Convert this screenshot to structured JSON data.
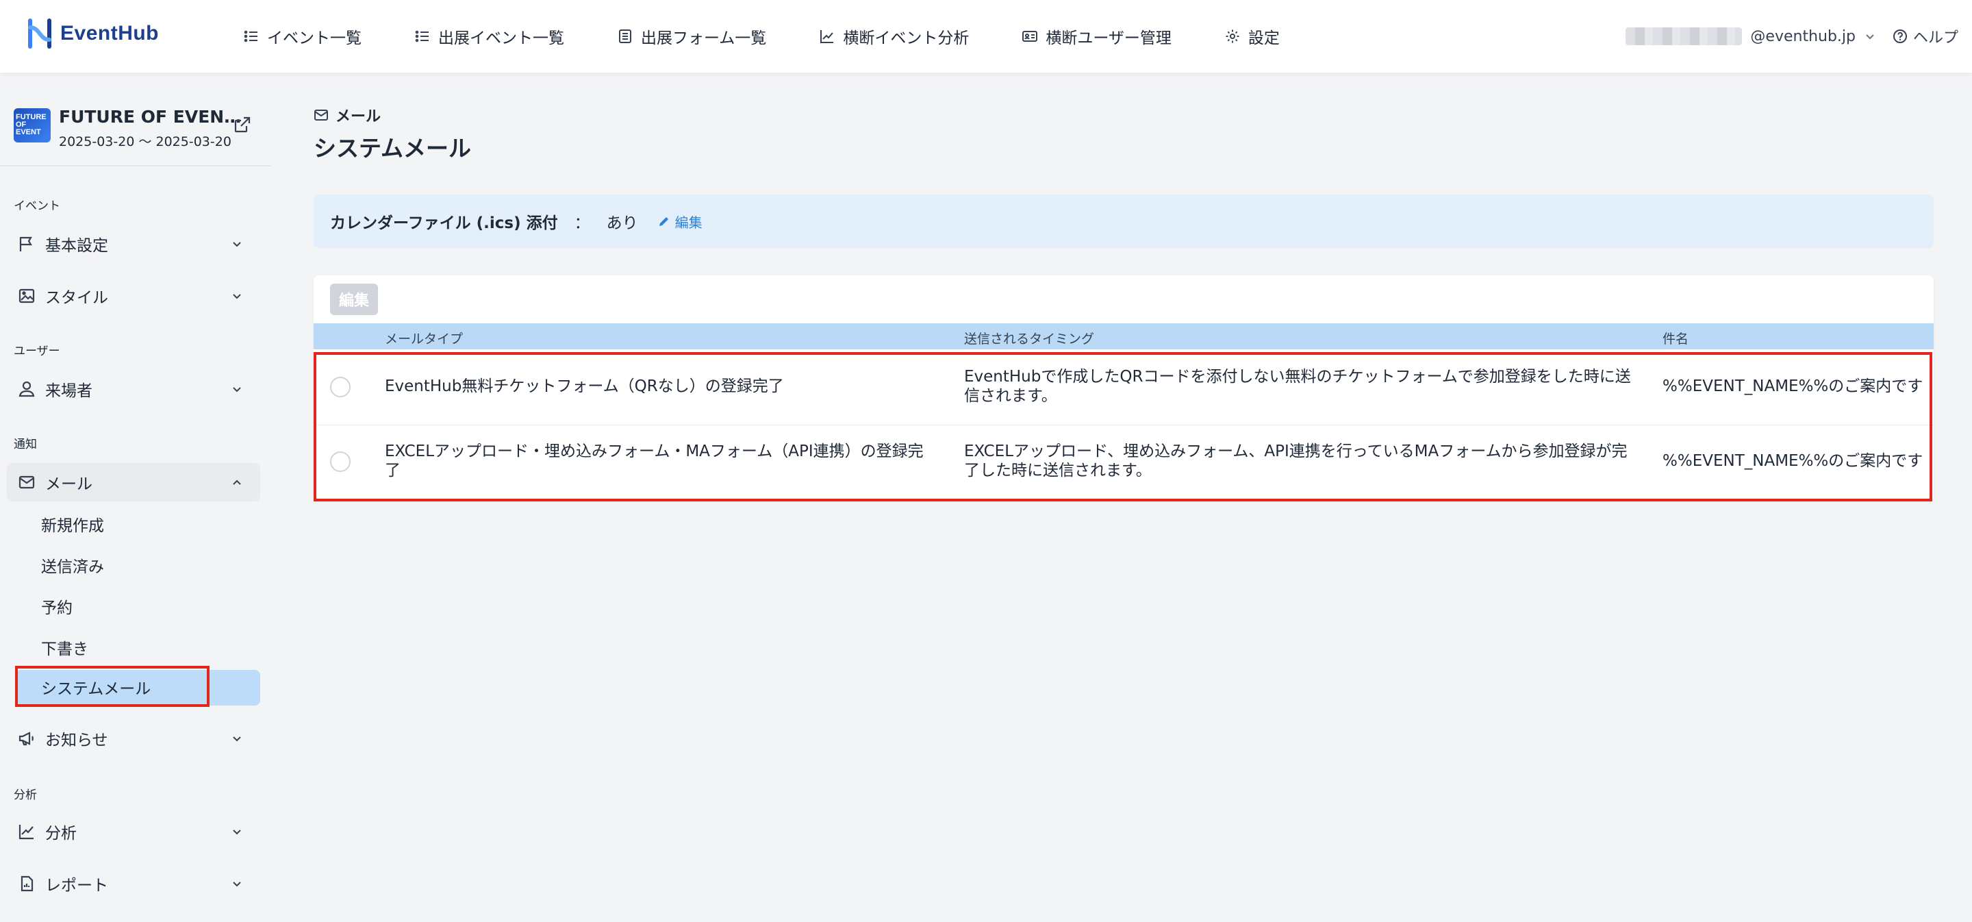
{
  "app": {
    "name": "EventHub"
  },
  "nav": {
    "items": [
      {
        "label": "イベント一覧",
        "icon": "list-icon"
      },
      {
        "label": "出展イベント一覧",
        "icon": "list-icon"
      },
      {
        "label": "出展フォーム一覧",
        "icon": "form-icon"
      },
      {
        "label": "横断イベント分析",
        "icon": "chart-icon"
      },
      {
        "label": "横断ユーザー管理",
        "icon": "id-card-icon"
      },
      {
        "label": "設定",
        "icon": "gear-icon"
      }
    ],
    "user_email_suffix": "@eventhub.jp",
    "help_label": "ヘルプ"
  },
  "sidebar": {
    "event": {
      "title": "FUTURE OF EVEN…",
      "dates": "2025-03-20 〜 2025-03-20",
      "thumb_text": "FUTURE OF EVENT"
    },
    "sections": {
      "event": "イベント",
      "user": "ユーザー",
      "notify": "通知",
      "analysis": "分析"
    },
    "items": {
      "basic": "基本設定",
      "style": "スタイル",
      "visitors": "来場者",
      "mail": "メール",
      "notice": "お知らせ",
      "analysis": "分析",
      "report": "レポート"
    },
    "mail_sub": {
      "new": "新規作成",
      "sent": "送信済み",
      "scheduled": "予約",
      "draft": "下書き",
      "system": "システムメール"
    }
  },
  "main": {
    "breadcrumb": "メール",
    "title": "システムメール",
    "ics": {
      "label": "カレンダーファイル (.ics) 添付",
      "colon": "：",
      "value": "あり",
      "edit": "編集"
    },
    "edit_button": "編集",
    "table": {
      "headers": [
        "メールタイプ",
        "送信されるタイミング",
        "件名"
      ],
      "rows": [
        {
          "type": "EventHub無料チケットフォーム（QRなし）の登録完了",
          "timing": "EventHubで作成したQRコードを添付しない無料のチケットフォームで参加登録をした時に送信されます。",
          "subject": "%%EVENT_NAME%%のご案内です"
        },
        {
          "type": "EXCELアップロード・埋め込みフォーム・MAフォーム（API連携）の登録完了",
          "timing": "EXCELアップロード、埋め込みフォーム、API連携を行っているMAフォームから参加登録が完了した時に送信されます。",
          "subject": "%%EVENT_NAME%%のご案内です"
        }
      ]
    }
  },
  "colors": {
    "brand": "#1d3f8f",
    "active_sub_bg": "#bcdcfa",
    "table_header_bg": "#b9d9f7",
    "ics_bar_bg": "#e3effb",
    "highlight": "#e3261b",
    "link": "#2f7fd6"
  }
}
